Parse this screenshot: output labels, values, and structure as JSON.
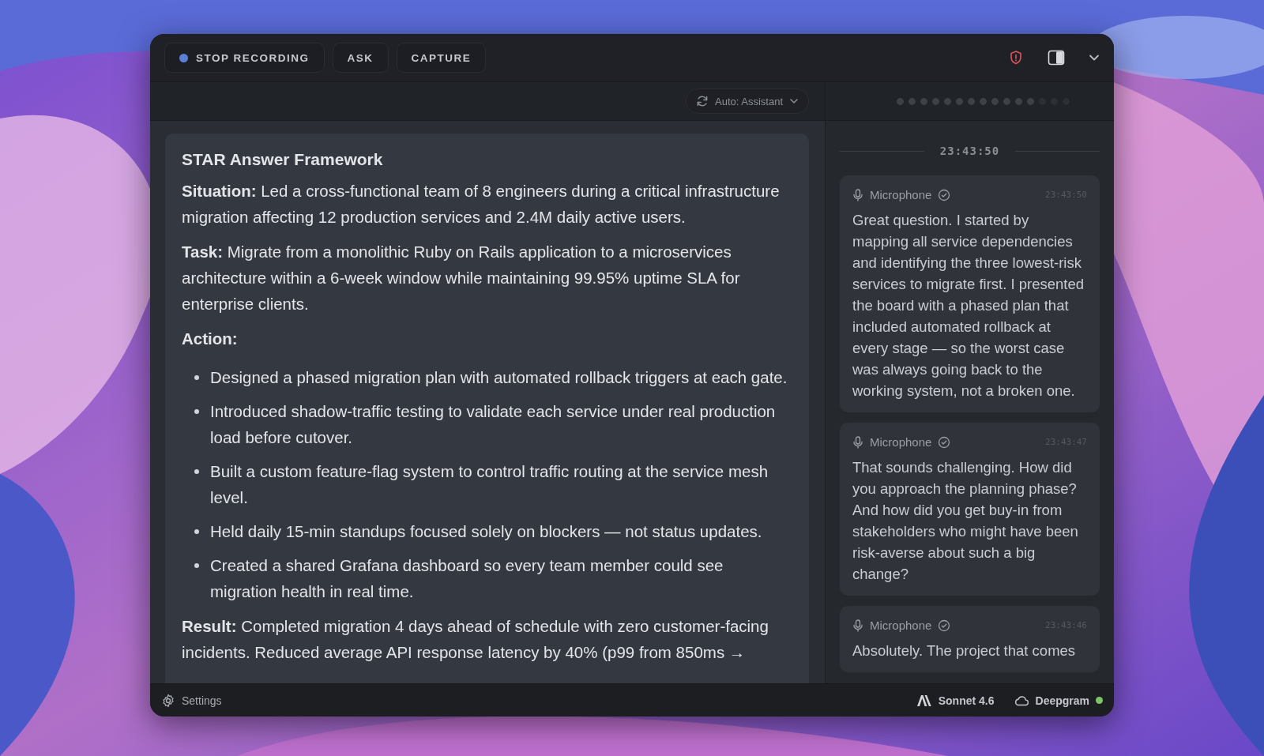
{
  "toolbar": {
    "buttons": [
      {
        "label": "STOP RECORDING",
        "kind": "record",
        "recording": true
      },
      {
        "label": "ASK",
        "kind": "plain"
      },
      {
        "label": "CAPTURE",
        "kind": "plain"
      }
    ]
  },
  "mode_selector": {
    "value": "Auto: Assistant"
  },
  "audio_meter": {
    "level": 0.8
  },
  "answer": {
    "title": "STAR Answer Framework",
    "blocks": [
      {
        "kind": "paragraph",
        "text": "**Situation:** Led a cross-functional team of 8 engineers during a critical infrastructure migration affecting 12 production services and 2.4M daily active users."
      },
      {
        "kind": "paragraph",
        "text": "**Task:** Migrate from a monolithic Ruby on Rails application to a microservices architecture within a 6-week window while maintaining 99.95% uptime SLA for enterprise clients."
      },
      {
        "kind": "heading",
        "text": "Action:"
      },
      {
        "kind": "bullets",
        "items": [
          "Designed a phased migration plan with automated rollback triggers at each gate.",
          "Introduced shadow-traffic testing to validate each service under real production load before cutover.",
          "Built a custom feature-flag system to control traffic routing at the service mesh level.",
          "Held daily 15-min standups focused solely on blockers — not status updates.",
          "Created a shared Grafana dashboard so every team member could see migration health in real time."
        ]
      },
      {
        "kind": "paragraph",
        "text": "**Result:** Completed migration 4 days ahead of schedule with zero customer-facing incidents. Reduced average API response latency by 40% (p99 from 850ms →"
      }
    ]
  },
  "transcript": {
    "time_divider": "23:43:50",
    "entries": [
      {
        "source": "Microphone",
        "verified": true,
        "time": "23:43:50",
        "text": "Great question. I started by mapping all service dependencies and identifying the three lowest-risk services to migrate first. I presented the board with a phased plan that included automated rollback at every stage — so the worst case was always going back to the working system, not a broken one."
      },
      {
        "source": "Microphone",
        "verified": true,
        "time": "23:43:47",
        "text": "That sounds challenging. How did you approach the planning phase? And how did you get buy-in from stakeholders who might have been risk-averse about such a big change?"
      },
      {
        "source": "Microphone",
        "verified": true,
        "time": "23:43:46",
        "text": "Absolutely. The project that comes"
      }
    ]
  },
  "status_bar": {
    "settings": "Settings",
    "model": "Sonnet 4.6",
    "transcriber": "Deepgram",
    "transcriber_online": true
  }
}
